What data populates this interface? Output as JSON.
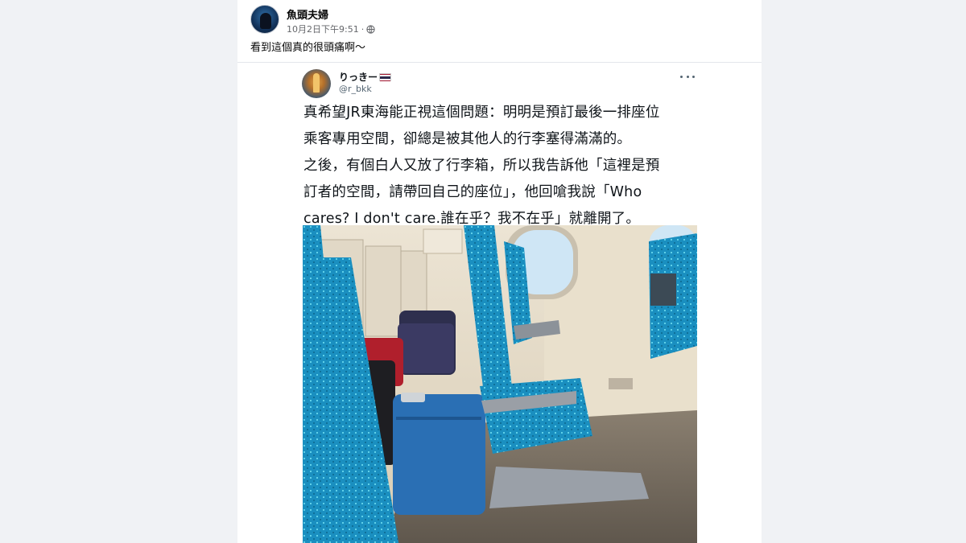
{
  "post": {
    "author": "魚頭夫婦",
    "timestamp": "10月2日下午9:51",
    "separator": "·",
    "caption": "看到這個真的很頭痛啊～"
  },
  "embed": {
    "display_name": "りっきー",
    "handle": "@r_bkk",
    "text_lines": [
      "真希望JR東海能正視這個問題：明明是預訂最後一排座位",
      "乘客專用空間，卻總是被其他人的行李塞得滿滿的。",
      "之後，有個白人又放了行李箱，所以我告訴他「這裡是預",
      "訂者的空間，請帶回自己的座位」，他回嗆我說「Who",
      "cares? I don't care.誰在乎？我不在乎」就離開了。"
    ]
  },
  "icons": {
    "globe": "globe-icon",
    "flag": "thailand-flag-icon",
    "more": "more-options-icon"
  },
  "colors": {
    "page_bg": "#f0f2f5",
    "seat_blue": "#1a8fc0",
    "wall_beige": "#e6dcc8",
    "flag_red": "#a51931",
    "flag_white": "#f4f5f8",
    "flag_blue": "#2d2a4a"
  }
}
